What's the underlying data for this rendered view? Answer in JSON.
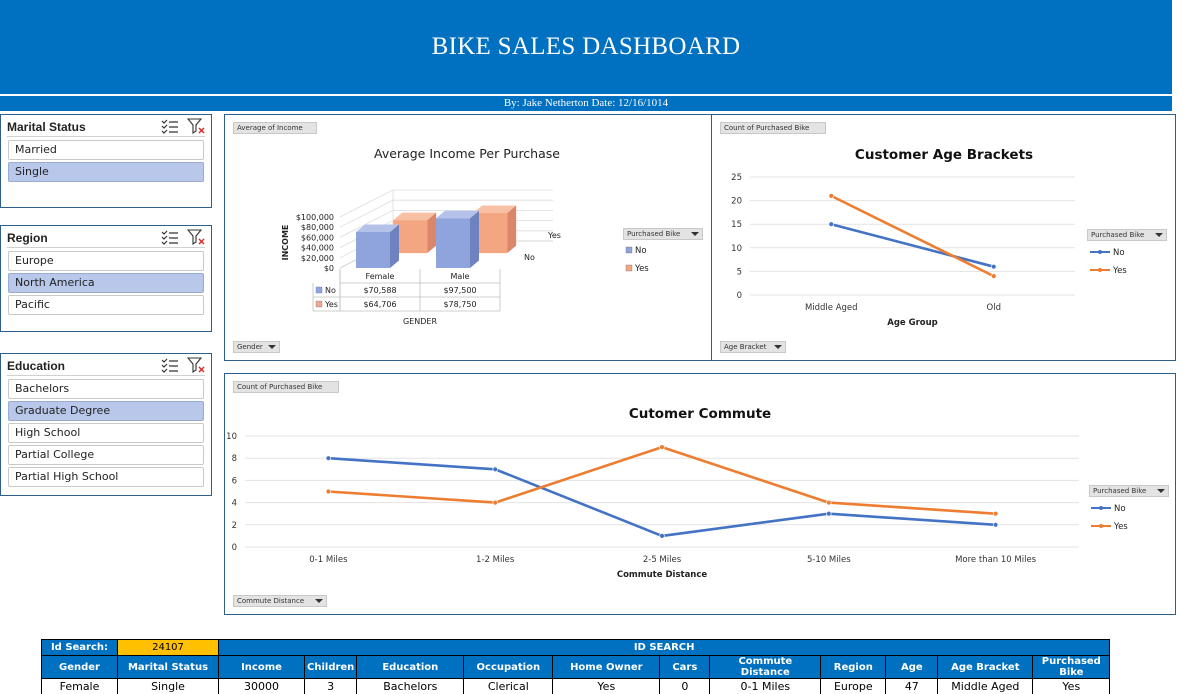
{
  "header": {
    "title": "BIKE SALES DASHBOARD",
    "byline": "By: Jake Netherton Date: 12/16/1014"
  },
  "slicers": {
    "marital": {
      "title": "Marital Status",
      "items": [
        {
          "label": "Married",
          "selected": false
        },
        {
          "label": "Single",
          "selected": true
        }
      ]
    },
    "region": {
      "title": "Region",
      "items": [
        {
          "label": "Europe",
          "selected": false
        },
        {
          "label": "North America",
          "selected": true
        },
        {
          "label": "Pacific",
          "selected": false
        }
      ]
    },
    "education": {
      "title": "Education",
      "items": [
        {
          "label": "Bachelors",
          "selected": false
        },
        {
          "label": "Graduate Degree",
          "selected": true
        },
        {
          "label": "High School",
          "selected": false
        },
        {
          "label": "Partial College",
          "selected": false
        },
        {
          "label": "Partial High School",
          "selected": false
        }
      ]
    },
    "icons": [
      "multi-select-icon",
      "clear-filter-icon"
    ]
  },
  "colors": {
    "accent": "#0070c0",
    "series_no": "#4472c4",
    "series_yes": "#ed7d31",
    "bar_no": "#8fa3dc",
    "bar_yes": "#f4a582",
    "selected": "#b8c7ea",
    "id_highlight": "#ffc000"
  },
  "chart_data": [
    {
      "type": "bar",
      "title": "Average Income Per Purchase",
      "field_buttons": {
        "values": "Average of Income",
        "axis": "Gender",
        "legend": "Purchased Bike"
      },
      "categories": [
        "Female",
        "Male"
      ],
      "xlabel": "GENDER",
      "ylabel": "INCOME",
      "yticks": [
        "$0",
        "$20,000",
        "$40,000",
        "$60,000",
        "$80,000",
        "$100,000"
      ],
      "ylim": [
        0,
        100000
      ],
      "depth_labels": [
        "Yes",
        "No"
      ],
      "series": [
        {
          "name": "No",
          "values": [
            70588,
            97500
          ],
          "labels": [
            "$70,588",
            "$97,500"
          ]
        },
        {
          "name": "Yes",
          "values": [
            64706,
            78750
          ],
          "labels": [
            "$64,706",
            "$78,750"
          ]
        }
      ],
      "legend_title": "Purchased Bike"
    },
    {
      "type": "line",
      "title": "Customer Age Brackets",
      "field_buttons": {
        "values": "Count of Purchased Bike",
        "axis": "Age Bracket",
        "legend": "Purchased Bike"
      },
      "categories": [
        "Middle Aged",
        "Old"
      ],
      "xlabel": "Age Group",
      "ylim": [
        0,
        25
      ],
      "yticks": [
        0,
        5,
        10,
        15,
        20,
        25
      ],
      "series": [
        {
          "name": "No",
          "values": [
            15,
            6
          ]
        },
        {
          "name": "Yes",
          "values": [
            21,
            4
          ]
        }
      ],
      "legend_title": "Purchased Bike"
    },
    {
      "type": "line",
      "title": "Cutomer Commute",
      "field_buttons": {
        "values": "Count of Purchased Bike",
        "axis": "Commute Distance",
        "legend": "Purchased Bike"
      },
      "categories": [
        "0-1 Miles",
        "1-2 Miles",
        "2-5 Miles",
        "5-10 Miles",
        "More than 10 Miles"
      ],
      "xlabel": "Commute Distance",
      "ylim": [
        0,
        10
      ],
      "yticks": [
        0,
        2,
        4,
        6,
        8,
        10
      ],
      "series": [
        {
          "name": "No",
          "values": [
            8,
            7,
            1,
            3,
            2
          ]
        },
        {
          "name": "Yes",
          "values": [
            5,
            4,
            9,
            4,
            3
          ]
        }
      ],
      "legend_title": "Purchased Bike"
    }
  ],
  "id_search": {
    "label": "Id Search:",
    "value": "24107",
    "banner": "ID SEARCH",
    "columns": [
      "Gender",
      "Marital Status",
      "Income",
      "Children",
      "Education",
      "Occupation",
      "Home Owner",
      "Cars",
      "Commute Distance",
      "Region",
      "Age",
      "Age Bracket",
      "Purchased Bike"
    ],
    "row": [
      "Female",
      "Single",
      "30000",
      "3",
      "Bachelors",
      "Clerical",
      "Yes",
      "0",
      "0-1 Miles",
      "Europe",
      "47",
      "Middle Aged",
      "Yes"
    ]
  }
}
